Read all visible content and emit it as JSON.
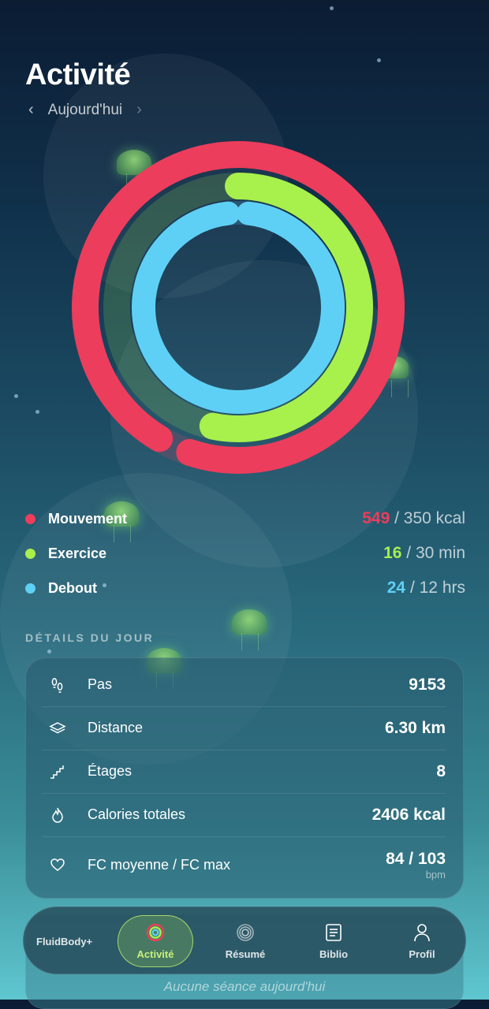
{
  "header": {
    "title": "Activité",
    "date_label": "Aujourd'hui"
  },
  "rings": {
    "move": {
      "value": 549,
      "goal": 350,
      "color": "#ec3d5c"
    },
    "exercise": {
      "value": 16,
      "goal": 30,
      "color": "#a8f04c"
    },
    "stand": {
      "value": 24,
      "goal": 12,
      "color": "#5fd0f5"
    }
  },
  "legend": [
    {
      "label": "Mouvement",
      "value": "549",
      "rest": "/ 350 kcal",
      "color": "#ec3d5c"
    },
    {
      "label": "Exercice",
      "value": "16",
      "rest": "/ 30 min",
      "color": "#a8f04c"
    },
    {
      "label": "Debout",
      "value": "24",
      "rest": "/ 12 hrs",
      "color": "#5fd0f5"
    }
  ],
  "details": {
    "section_title": "DÉTAILS DU JOUR",
    "rows": [
      {
        "icon": "footprints-icon",
        "label": "Pas",
        "value": "9153"
      },
      {
        "icon": "layers-icon",
        "label": "Distance",
        "value": "6.30 km"
      },
      {
        "icon": "stairs-icon",
        "label": "Étages",
        "value": "8"
      },
      {
        "icon": "flame-icon",
        "label": "Calories totales",
        "value": "2406 kcal"
      },
      {
        "icon": "heart-icon",
        "label": "FC moyenne / FC max",
        "value": "84 / 103",
        "unit": "bpm"
      }
    ]
  },
  "sessions": {
    "empty_text": "Aucune séance aujourd'hui"
  },
  "tabbar": {
    "brand": "FluidBody+",
    "tabs": [
      {
        "label": "Activité",
        "icon": "activity-rings-icon",
        "active": true
      },
      {
        "label": "Résumé",
        "icon": "spiral-icon",
        "active": false
      },
      {
        "label": "Biblio",
        "icon": "book-icon",
        "active": false
      },
      {
        "label": "Profil",
        "icon": "person-icon",
        "active": false
      }
    ]
  }
}
